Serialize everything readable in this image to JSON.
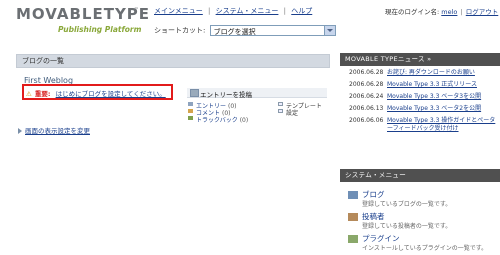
{
  "app": {
    "logo_main": "MOVABLETYPE",
    "logo_tm": "™",
    "logo_sub": "Publishing Platform"
  },
  "nav": {
    "main_menu": "メインメニュー",
    "system_menu": "システム・メニュー",
    "help": "ヘルプ",
    "separator": "|"
  },
  "login": {
    "label": "現在のログイン名:",
    "username": "melo",
    "logout": "ログアウト",
    "separator": "|"
  },
  "shortcut": {
    "label": "ショートカット:",
    "selected": "ブログを選択"
  },
  "blogs": {
    "header": "ブログの一覧",
    "name": "First Weblog",
    "alert_icon": "⚠",
    "alert_label": "重要:",
    "alert_link": "はじめにブログを設定してください。",
    "post_entry": "エントリーを投稿",
    "stats": [
      {
        "label": "エントリー",
        "count": "(0)",
        "color": "#8ea3be"
      },
      {
        "label": "コメント",
        "count": "(0)",
        "color": "#d4a44c"
      },
      {
        "label": "トラックバック",
        "count": "(0)",
        "color": "#7fa04c"
      }
    ],
    "links": [
      {
        "label": "テンプレート"
      },
      {
        "label": "設定"
      }
    ]
  },
  "display_settings": "画面の表示設定を変更",
  "news": {
    "header": "MOVABLE TYPEニュース »",
    "items": [
      {
        "date": "2006.06.28",
        "title": "お詫び: 再ダウンロードのお願い"
      },
      {
        "date": "2006.06.28",
        "title": "Movable Type 3.3 正式リリース"
      },
      {
        "date": "2006.06.24",
        "title": "Movable Type 3.3 ベータ3を公開"
      },
      {
        "date": "2006.06.13",
        "title": "Movable Type 3.3 ベータ2を公開"
      },
      {
        "date": "2006.06.06",
        "title": "Movable Type 3.3 操作ガイドとペーターフィードバック受け付け"
      }
    ]
  },
  "system_menu": {
    "header": "システム・メニュー",
    "items": [
      {
        "title": "ブログ",
        "desc": "登録しているブログの一覧です。",
        "icon_color": "#6f8fb6"
      },
      {
        "title": "投稿者",
        "desc": "登録している投稿者の一覧です。",
        "icon_color": "#b58a5b"
      },
      {
        "title": "プラグイン",
        "desc": "インストールしているプラグインの一覧です。",
        "icon_color": "#8aa86a"
      }
    ]
  }
}
